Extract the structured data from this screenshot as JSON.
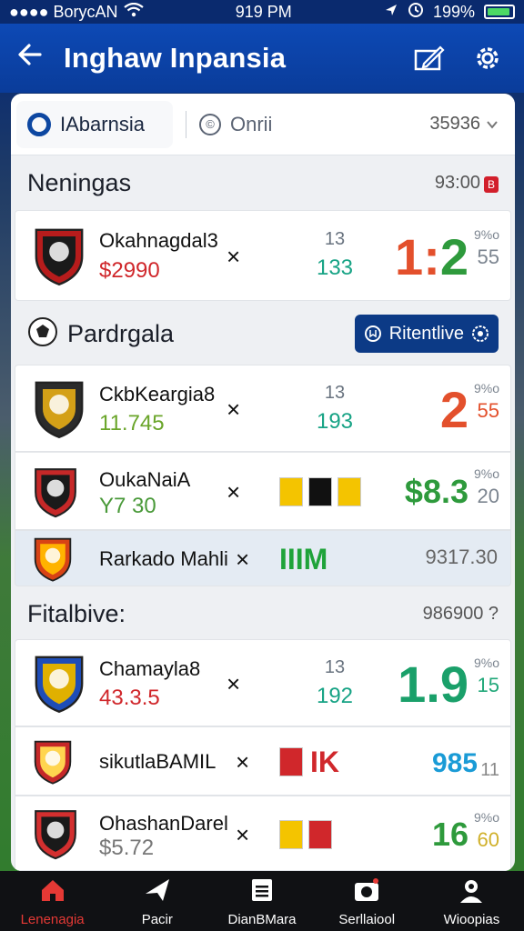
{
  "status_bar": {
    "carrier": "●●●● BorycAN",
    "time": "919 PM",
    "battery": "199%"
  },
  "header": {
    "title": "Inghaw Inpansia"
  },
  "tabs": {
    "active": "IAbarnsia",
    "other": "Onrii",
    "count": "35936",
    "other_icon": "©"
  },
  "sections": [
    {
      "title": "Neningas",
      "value": "93:00",
      "badge": "B"
    },
    {
      "title": "Pardrgala",
      "button_label": "Ritentlive"
    },
    {
      "title": "Fitalbive:",
      "value": "986900 ?"
    }
  ],
  "matches": [
    {
      "team": "Okahnagdal3",
      "sub": "$2990",
      "sub_color": "#d0272b",
      "vs": "×",
      "mid_top": "13",
      "mid_bottom": "133",
      "score": "1:2",
      "score_parts": [
        "1",
        ":",
        "2"
      ],
      "score_colors": [
        "#e3502c",
        "#e3502c",
        "#2e9a3c"
      ],
      "side_top": "9%o",
      "side_bottom": "55",
      "crest_color": "#b71c1c",
      "crest_accent": "#1a1a1a"
    },
    {
      "team": "CkbKeargia8",
      "sub": "11.745",
      "sub_color": "#6aa52a",
      "vs": "×",
      "mid_top": "13",
      "mid_bottom": "193",
      "score": "2",
      "score_parts": [
        "2"
      ],
      "score_colors": [
        "#e3502c"
      ],
      "side_top": "9%o",
      "side_bottom": "55",
      "side_color": "#e3502c",
      "crest_color": "#2b2b2b",
      "crest_accent": "#d4a017"
    },
    {
      "team": "OukaNaiA",
      "sub": "Y7 30",
      "sub_color": "#4a9a3a",
      "vs": "×",
      "mid_top": "",
      "mid_bottom": "",
      "score": "$8.3",
      "score_parts": [
        "$8.3"
      ],
      "score_colors": [
        "#2e9a3c"
      ],
      "side_top": "9%o",
      "side_bottom": "20",
      "crest_color": "#c62828",
      "crest_accent": "#1a1a1a",
      "flags": [
        "#f4c400",
        "#111111",
        "#f4c400"
      ]
    },
    {
      "team": "Rarkado Mahli",
      "sub": "",
      "vs": "×",
      "score": "IIIM",
      "score_parts": [
        "IIIM"
      ],
      "score_colors": [
        "#1fa33a"
      ],
      "side_top": "",
      "side_bottom": "",
      "right_text": "9317.30",
      "crest_color": "#d84315",
      "crest_accent": "#ffb300"
    },
    {
      "team": "Chamayla8",
      "sub": "43.3.5",
      "sub_color": "#d0272b",
      "vs": "×",
      "mid_top": "13",
      "mid_bottom": "192",
      "score": "1.9",
      "score_parts": [
        "1.9"
      ],
      "score_colors": [
        "#1aa06a"
      ],
      "side_top": "9%o",
      "side_bottom": "15",
      "side_color": "#22a87a",
      "crest_color": "#1e4db7",
      "crest_accent": "#e0b000"
    },
    {
      "team": "sikutlaBAMIL",
      "sub": "",
      "vs": "×",
      "score": "IK",
      "score_parts": [
        "IK"
      ],
      "score_colors": [
        "#d0272b"
      ],
      "side_top": "",
      "side_bottom": "",
      "right_text": "985",
      "right_side": "11",
      "crest_color": "#c62828",
      "crest_accent": "#ffd54f",
      "flags": [
        "#d0272b"
      ]
    },
    {
      "team": "OhashanDarel",
      "sub": "$5.72",
      "sub_color": "#777777",
      "vs": "×",
      "score": "16",
      "score_parts": [
        "16"
      ],
      "score_colors": [
        "#2e9a3c"
      ],
      "side_top": "9%o",
      "side_bottom": "60",
      "side_color": "#d0b02a",
      "crest_color": "#d32f2f",
      "crest_accent": "#1a1a1a",
      "flags": [
        "#f4c400",
        "#d0272b"
      ]
    }
  ],
  "nav": [
    {
      "label": "Lenenagia",
      "icon": "home-icon",
      "active": true
    },
    {
      "label": "Pacir",
      "icon": "plane-icon",
      "active": false
    },
    {
      "label": "DianBMara",
      "icon": "list-icon",
      "active": false
    },
    {
      "label": "Serllaiool",
      "icon": "camera-icon",
      "active": false
    },
    {
      "label": "Wioopias",
      "icon": "people-icon",
      "active": false
    }
  ],
  "colors": {
    "header": "#0d49b5",
    "accent": "#0c3a86",
    "live": "#d21f2b"
  }
}
